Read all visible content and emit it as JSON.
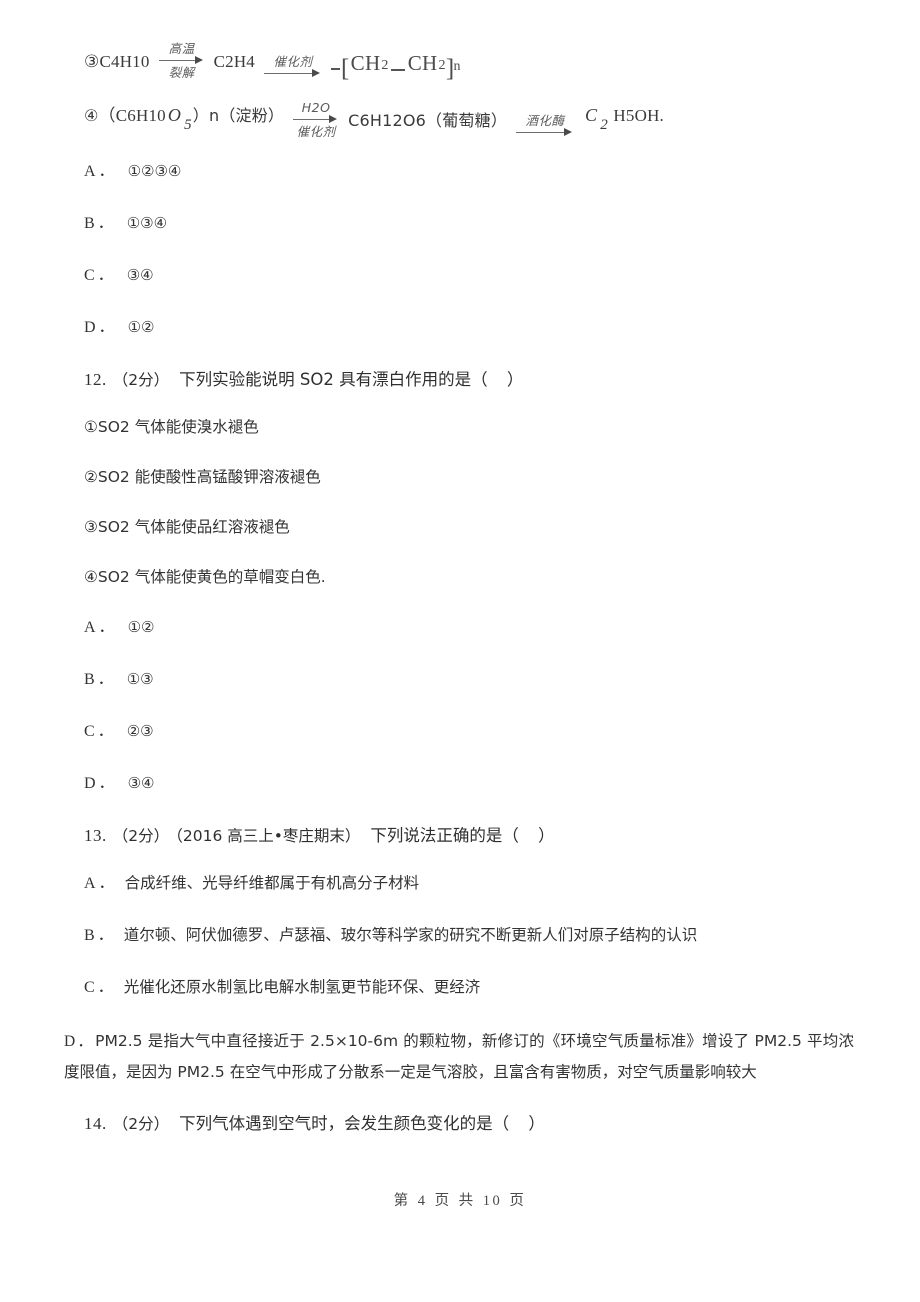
{
  "document": {
    "footer": {
      "prefix": "第",
      "current_page": "4",
      "middle": "页 共",
      "total_pages": "10",
      "suffix": "页",
      "full_text": "第 4 页 共 10 页"
    }
  },
  "equations": {
    "item3": {
      "marker": "③",
      "reactant": "C4H10",
      "arrow1": {
        "above": "高温",
        "below": "裂解"
      },
      "intermediate": "C2H4",
      "arrow2": {
        "above": "催化剂",
        "below": ""
      },
      "product_lead": "-",
      "product_bracket_open": "[",
      "product_unit1": "CH",
      "product_unit1_sub": "2",
      "product_unit2": "CH",
      "product_unit2_sub": "2",
      "product_bracket_close": "]",
      "product_n": "n"
    },
    "item4": {
      "marker": "④",
      "reactant_open": "（C6H10",
      "reactant_sub_var": "O",
      "reactant_sub_num": "5",
      "reactant_close": "）n（淀粉）",
      "arrow1": {
        "above": "H2O",
        "below": "催化剂"
      },
      "intermediate": "C6H12O6（葡萄糖）",
      "arrow2": {
        "above": "酒化酶",
        "below": ""
      },
      "product_var": "C",
      "product_var_sub": "2",
      "product_rest": "H5OH."
    }
  },
  "q11_options": [
    {
      "label": "A．",
      "choices": "①②③④"
    },
    {
      "label": "B．",
      "choices": "①③④"
    },
    {
      "label": "C．",
      "choices": "③④"
    },
    {
      "label": "D．",
      "choices": "①②"
    }
  ],
  "q12": {
    "number": "12.",
    "score": "（2分）",
    "stem": "下列实验能说明 SO2 具有漂白作用的是（",
    "stem_close": "）",
    "statements": [
      "①SO2 气体能使溴水褪色",
      "②SO2 能使酸性高锰酸钾溶液褪色",
      "③SO2 气体能使品红溶液褪色",
      "④SO2 气体能使黄色的草帽变白色."
    ],
    "options": [
      {
        "label": "A．",
        "choices": "①②"
      },
      {
        "label": "B．",
        "choices": "①③"
      },
      {
        "label": "C．",
        "choices": "②③"
      },
      {
        "label": "D．",
        "choices": "③④"
      }
    ]
  },
  "q13": {
    "number": "13.",
    "score": "（2分）",
    "source": "（2016 高三上•枣庄期末）",
    "stem": "下列说法正确的是（",
    "stem_close": "）",
    "options": [
      {
        "label": "A．",
        "text": "合成纤维、光导纤维都属于有机高分子材料"
      },
      {
        "label": "B．",
        "text": "道尔顿、阿伏伽德罗、卢瑟福、玻尔等科学家的研究不断更新人们对原子结构的认识"
      },
      {
        "label": "C．",
        "text": "光催化还原水制氢比电解水制氢更节能环保、更经济"
      }
    ],
    "option_d": {
      "label": "D．",
      "text": "PM2.5 是指大气中直径接近于 2.5×10‑6m 的颗粒物，新修订的《环境空气质量标准》增设了 PM2.5 平均浓度限值，是因为 PM2.5 在空气中形成了分散系一定是气溶胶，且富含有害物质，对空气质量影响较大"
    }
  },
  "q14": {
    "number": "14.",
    "score": "（2分）",
    "stem": "下列气体遇到空气时，会发生颜色变化的是（",
    "stem_close": "）"
  }
}
